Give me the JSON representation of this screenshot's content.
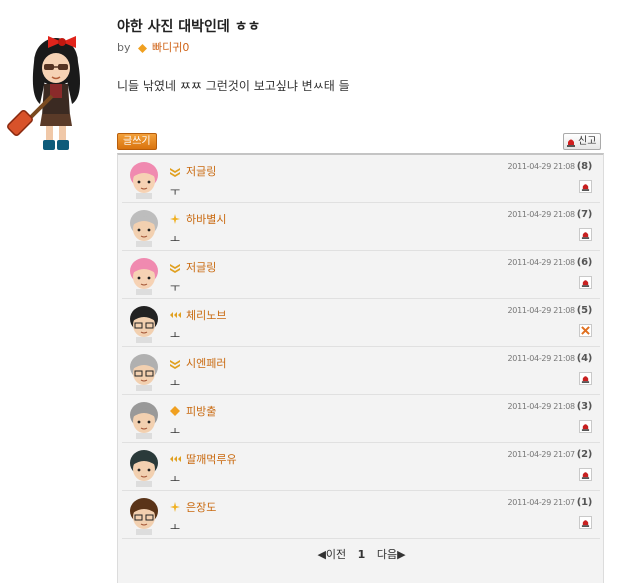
{
  "post": {
    "title": "야한 사진 대박인데 ㅎㅎ",
    "by_label": "by",
    "author": "빠디귀0",
    "body": "니들 낚였네 ㅉㅉ 그런것이 보고싶냐 변ㅆ태 들"
  },
  "buttons": {
    "write": "글쓰기",
    "report": "신고"
  },
  "comments": [
    {
      "nick": "저글링",
      "text": "ㅜ",
      "time": "2011-04-29 21:08",
      "num": "(8)",
      "action": "report-icon",
      "rank": "chevron"
    },
    {
      "nick": "하바별시",
      "text": "ㅗ",
      "time": "2011-04-29 21:08",
      "num": "(7)",
      "action": "report-icon",
      "rank": "star"
    },
    {
      "nick": "저글링",
      "text": "ㅜ",
      "time": "2011-04-29 21:08",
      "num": "(6)",
      "action": "report-icon",
      "rank": "chevron"
    },
    {
      "nick": "체리노브",
      "text": "ㅗ",
      "time": "2011-04-29 21:08",
      "num": "(5)",
      "action": "delete-icon",
      "rank": "triple-chevron"
    },
    {
      "nick": "시엔페러",
      "text": "ㅗ",
      "time": "2011-04-29 21:08",
      "num": "(4)",
      "action": "report-icon",
      "rank": "chevron"
    },
    {
      "nick": "피방출",
      "text": "ㅗ",
      "time": "2011-04-29 21:08",
      "num": "(3)",
      "action": "report-icon",
      "rank": "diamond"
    },
    {
      "nick": "딸깨먹루유",
      "text": "ㅗ",
      "time": "2011-04-29 21:07",
      "num": "(2)",
      "action": "report-icon",
      "rank": "triple-chevron"
    },
    {
      "nick": "은장도",
      "text": "ㅗ",
      "time": "2011-04-29 21:07",
      "num": "(1)",
      "action": "report-icon",
      "rank": "star"
    }
  ],
  "pager": {
    "prev": "◀이전",
    "current": "1",
    "next": "다음▶"
  },
  "colors": {
    "accent": "#d9730f",
    "nick": "#c96a10",
    "box_bg": "#f3f3f3"
  }
}
